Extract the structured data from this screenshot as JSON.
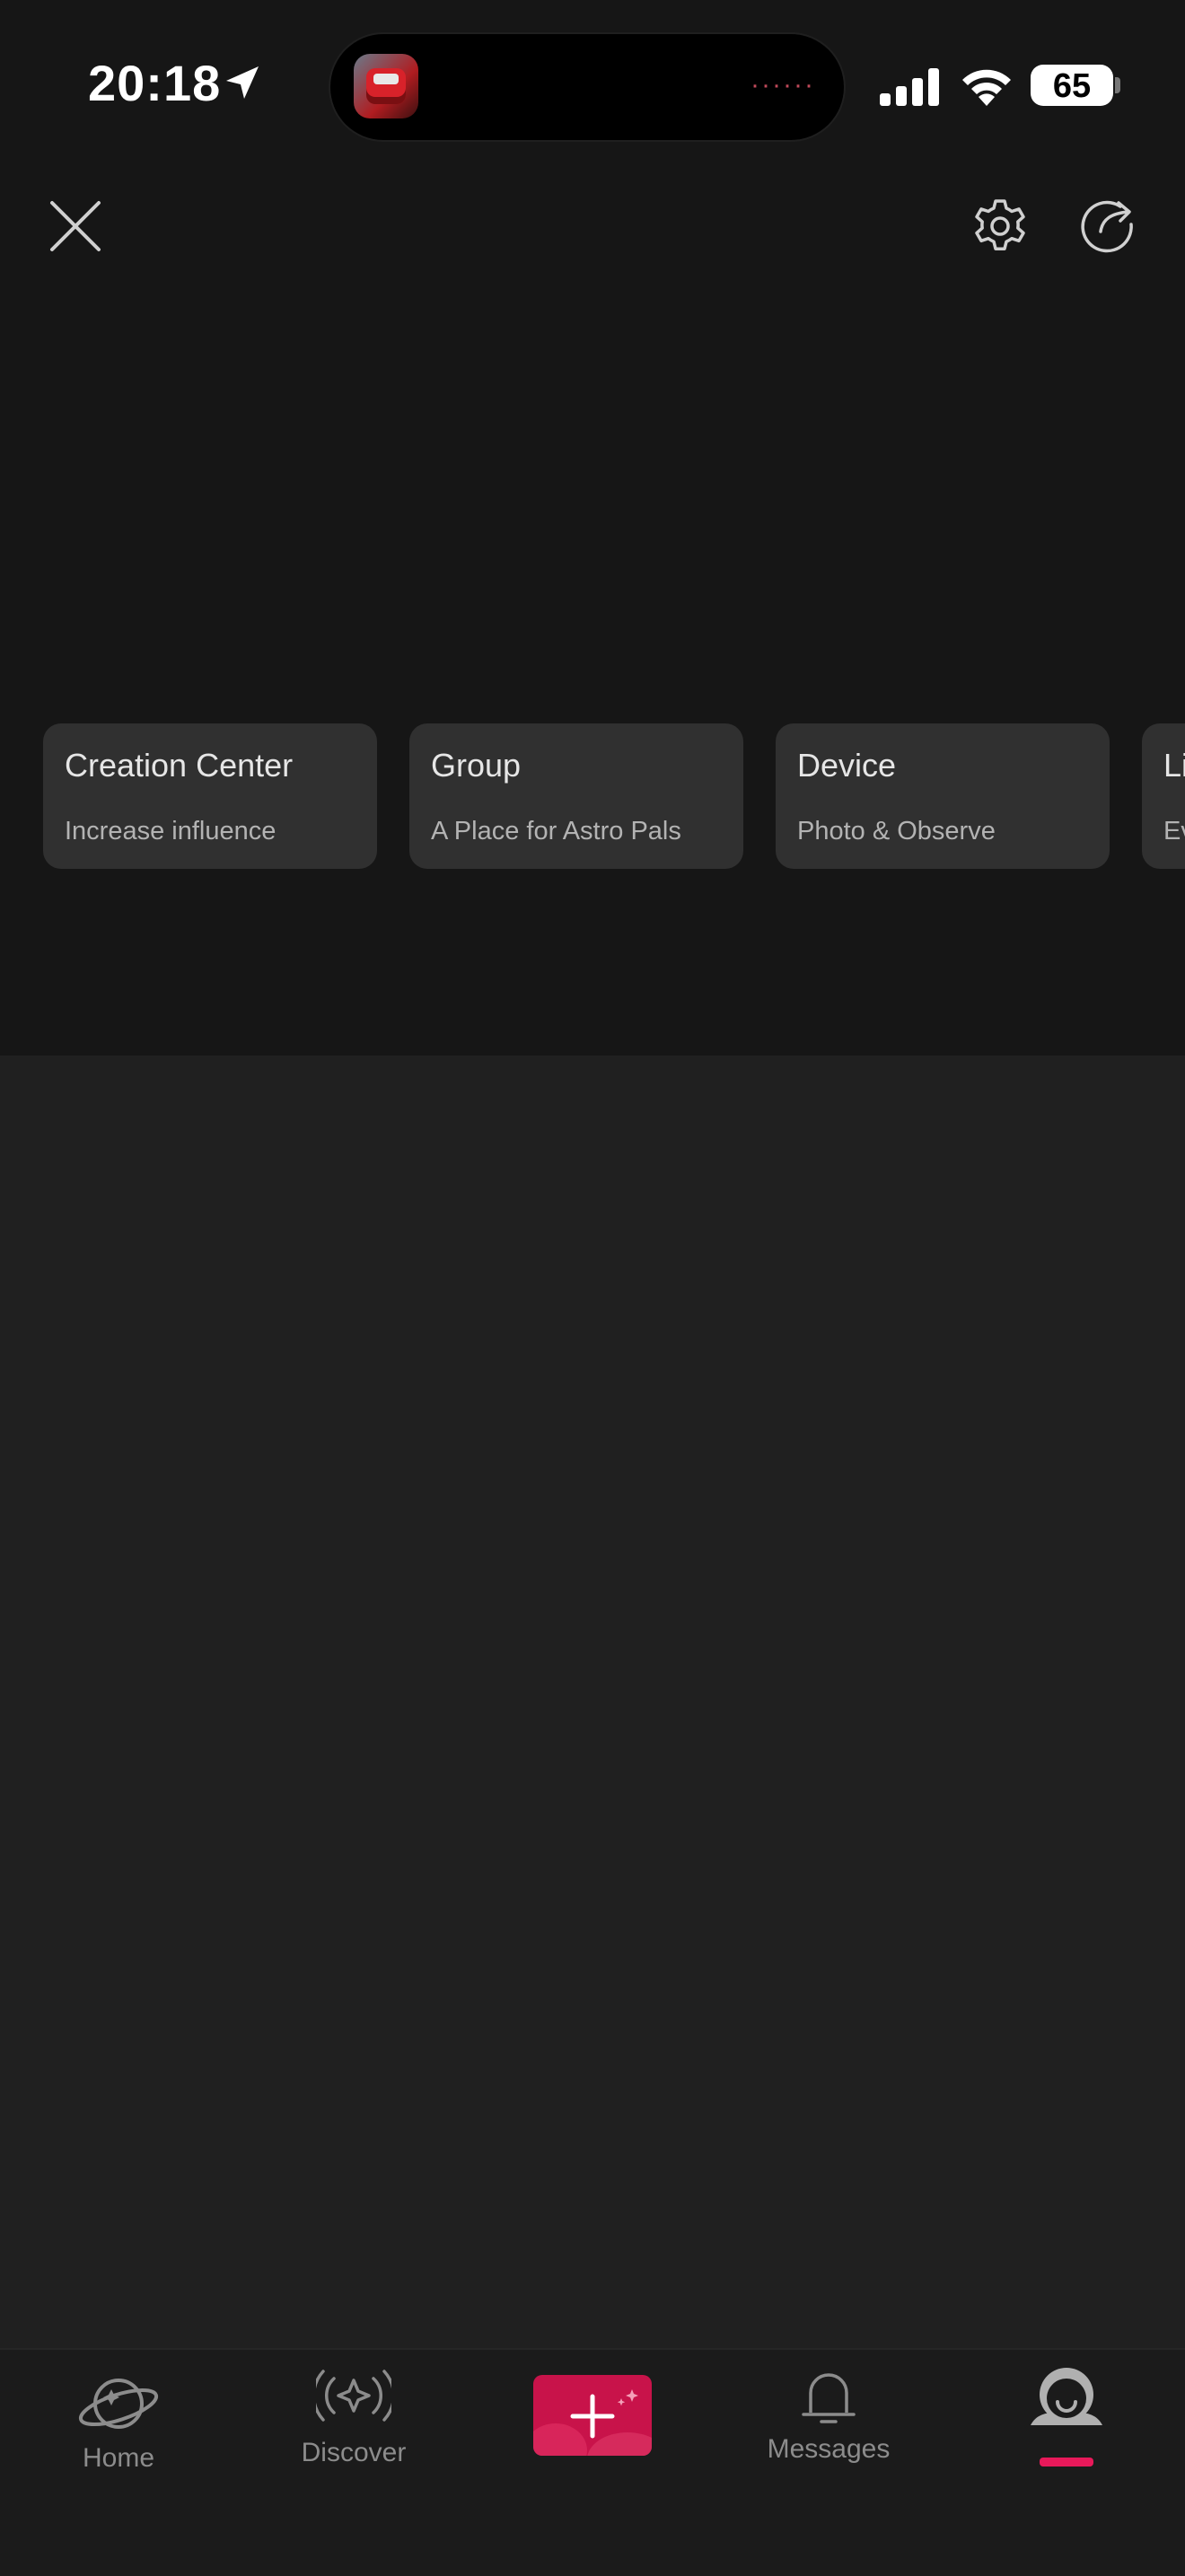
{
  "status_bar": {
    "time": "20:18",
    "battery": "65",
    "icons": [
      "location-arrow-icon",
      "signal-bars-icon",
      "wifi-icon",
      "battery-icon"
    ]
  },
  "header": {
    "close_icon": "close-icon",
    "settings_icon": "gear-icon",
    "share_icon": "share-icon"
  },
  "cards": [
    {
      "title": "Creation Center",
      "subtitle": "Increase influence"
    },
    {
      "title": "Group",
      "subtitle": "A Place for Astro Pals"
    },
    {
      "title": "Device",
      "subtitle": "Photo & Observe"
    },
    {
      "title": "Li",
      "subtitle": "Ev"
    }
  ],
  "tabbar": {
    "home": "Home",
    "discover": "Discover",
    "messages": "Messages",
    "active_tab": "me",
    "accent_color": "#e8195a"
  },
  "colors": {
    "top_background": "#161616",
    "page_background": "#202020",
    "card_background": "#303030",
    "create_button": "#c8134a"
  }
}
